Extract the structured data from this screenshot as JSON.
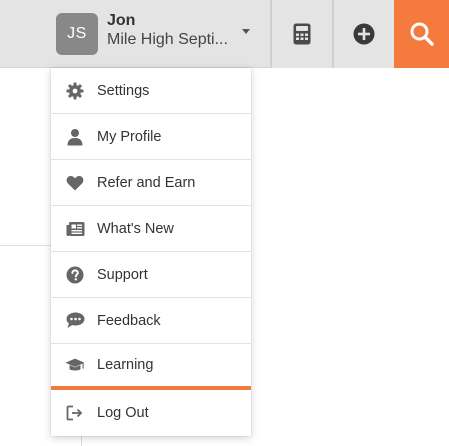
{
  "header": {
    "user_initials": "JS",
    "user_name": "Jon",
    "organization": "Mile High Septi...",
    "accent_color": "#f47b3d"
  },
  "toolbar": {
    "icons": [
      "calculator-icon",
      "plus-circle-icon",
      "search-icon"
    ]
  },
  "menu": {
    "items": [
      {
        "label": "Settings",
        "icon": "gear-icon"
      },
      {
        "label": "My Profile",
        "icon": "person-icon"
      },
      {
        "label": "Refer and Earn",
        "icon": "heart-icon"
      },
      {
        "label": "What's New",
        "icon": "newspaper-icon"
      },
      {
        "label": "Support",
        "icon": "question-circle-icon"
      },
      {
        "label": "Feedback",
        "icon": "speech-bubble-icon"
      },
      {
        "label": "Learning",
        "icon": "graduation-cap-icon"
      },
      {
        "label": "Log Out",
        "icon": "sign-out-icon"
      }
    ]
  }
}
